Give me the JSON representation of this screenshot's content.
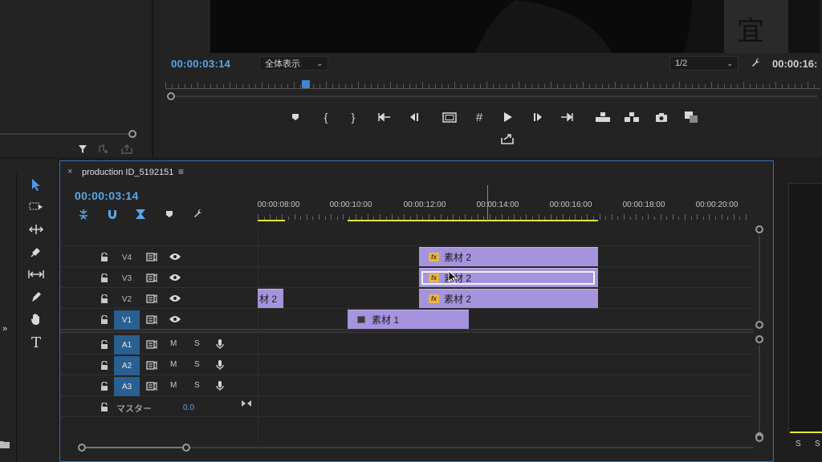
{
  "program_monitor": {
    "timecode": "00:00:03:14",
    "zoom_select": "全体表示",
    "resolution_select": "1/2",
    "duration": "00:00:16:"
  },
  "timeline": {
    "sequence_name": "production ID_5192151",
    "close_glyph": "×",
    "menu_glyph": "≡",
    "timecode": "00:00:03:14",
    "ruler_labels": [
      "00:00:08:00",
      "00:00:10:00",
      "00:00:12:00",
      "00:00:14:00",
      "00:00:16:00",
      "00:00:18:00",
      "00:00:20:00"
    ],
    "video_tracks": [
      {
        "name": "V4",
        "targeted": false
      },
      {
        "name": "V3",
        "targeted": false
      },
      {
        "name": "V2",
        "targeted": false
      },
      {
        "name": "V1",
        "targeted": true
      }
    ],
    "audio_tracks": [
      {
        "name": "A1",
        "targeted": true
      },
      {
        "name": "A2",
        "targeted": true
      },
      {
        "name": "A3",
        "targeted": true
      }
    ],
    "mute_label": "M",
    "solo_label": "S",
    "master_label": "マスター",
    "master_value": "0.0",
    "clips": {
      "v4_clip": "素材 2",
      "v3_clip": "素材 2",
      "v2_clip_left": "材 2",
      "v2_clip": "素材 2",
      "v1_clip": "素材 1"
    },
    "fx_label": "fx"
  },
  "right_meter": {
    "solo_buttons": [
      "S",
      "S"
    ]
  },
  "icons": [
    "filter-icon",
    "marker-icon",
    "in-point-icon",
    "out-point-icon",
    "go-to-in-icon",
    "step-back-icon",
    "safe-margins-icon",
    "grid-icon",
    "play-icon",
    "step-forward-icon",
    "go-to-out-icon",
    "lift-icon",
    "extract-icon",
    "camera-icon",
    "compare-icon",
    "export-icon",
    "wrench-icon",
    "selection-tool-icon",
    "track-select-icon",
    "ripple-edit-icon",
    "razor-icon",
    "slip-icon",
    "pen-icon",
    "hand-icon",
    "type-icon",
    "lock-icon",
    "toggle-output-icon",
    "eye-icon",
    "mic-icon",
    "snap-icon",
    "linked-icon"
  ],
  "colors": {
    "accent_blue": "#5aa7e6",
    "clip_purple": "#a594dd",
    "track_target": "#2a5f92",
    "work_area_yellow": "#e5e53a"
  }
}
